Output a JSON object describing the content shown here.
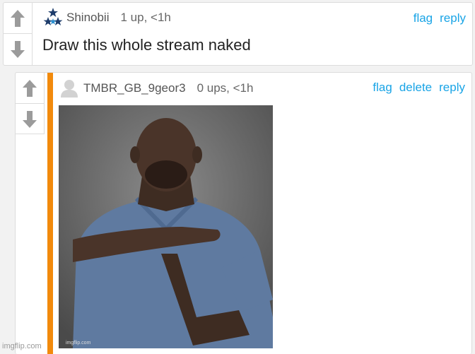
{
  "comments": [
    {
      "username": "Shinobii",
      "meta": "1 up, <1h",
      "text": "Draw this whole stream naked",
      "badge_icon": "stars-badge-icon",
      "actions": [
        "flag",
        "reply"
      ]
    },
    {
      "username": "TMBR_GB_9geor3",
      "meta": "0 ups, <1h",
      "avatar_icon": "default-avatar-icon",
      "image_watermark": "imgflip.com",
      "actions": [
        "flag",
        "delete",
        "reply"
      ]
    }
  ],
  "site_watermark": "imgflip.com",
  "colors": {
    "accent_link": "#19a4e6",
    "reply_bar": "#f28a0c",
    "arrow": "#9b9b9b"
  }
}
